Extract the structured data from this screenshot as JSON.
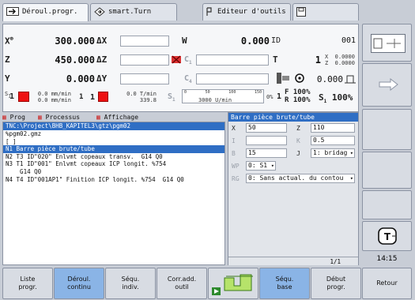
{
  "tabs": [
    {
      "label": "Déroul.progr.",
      "icon": "run-program-icon"
    },
    {
      "label": "smart.Turn",
      "icon": "smart-turn-icon"
    },
    {
      "label": "Editeur d'outils",
      "icon": "tool-editor-icon"
    },
    {
      "label": "",
      "icon": "disk-icon"
    }
  ],
  "axes": {
    "x": {
      "label": "X",
      "sup": "⊕",
      "value": "300.000",
      "delta": "ΔX"
    },
    "z": {
      "label": "Z",
      "value": "450.000",
      "delta": "ΔZ"
    },
    "y": {
      "label": "Y",
      "value": "0.000",
      "delta": "ΔY"
    },
    "w": {
      "label": "W",
      "value": "0.000",
      "id_label": "ID",
      "id_value": "001"
    },
    "c1": {
      "label": "C",
      "sub": "1"
    },
    "c2": {
      "label": "C",
      "sub": "4"
    },
    "t": {
      "label": "T",
      "value": "1",
      "x_label": "X",
      "x_value": "0.0000",
      "z_label": "Z",
      "z_value": "0.0000"
    },
    "spindle_value": "0.000"
  },
  "feeds": {
    "s1_label": "S",
    "s1_sub": "1",
    "s1_count": "1",
    "feed_top": "0.0 mm/min",
    "feed_bot": "0.0 mm/min",
    "k1": "1",
    "k2": "1",
    "feed2_top": "0.0 T/min",
    "feed2_bot": "339.8",
    "s2": "S",
    "s2_sub": "1",
    "rpm": "3000 U/min",
    "rpm_scale": [
      "0",
      "50",
      "100",
      "150"
    ],
    "percent": "0%",
    "f_label": "F",
    "f_pct": "100%",
    "r_label": "R",
    "r_pct": "100%",
    "s_label": "S",
    "s_sub": "1",
    "s_pct": "100%"
  },
  "menu": {
    "prog": "Prog",
    "processus": "Processus",
    "affichage": "Affichage"
  },
  "program": {
    "path": "TNC:\\Project\\BHB_KAPITEL3\\gtz\\pgm02",
    "lines": [
      "%pgm02.gmz",
      "[ ]",
      "N1 Barre pièce brute/tube",
      "N2 T3 ID\"020\" Enlvmt copeaux transv.  G14 Q0",
      "N3 T1 ID\"001\" Enlvmt copeaux ICP longit. %754",
      "    G14 Q0",
      "N4 T4 ID\"001AP1\" Finition ICP longit. %754  G14 Q0"
    ],
    "selected": 2,
    "page": "1/1"
  },
  "form": {
    "title": "Barre pièce brute/tube",
    "x_label": "X",
    "x_value": "50",
    "z_label": "Z",
    "z_value": "110",
    "i_label": "I",
    "i_value": "",
    "k_label": "K",
    "k_value": "0.5",
    "b_label": "B",
    "b_value": "15",
    "j_label": "J",
    "j_value": "1: bridag",
    "wp_label": "WP",
    "wp_value": "0: S1",
    "rg_label": "RG",
    "rg_value": "0: Sans actual. du contou"
  },
  "clock": "14:15",
  "bottom_keys": [
    {
      "label": "Liste\nprogr.",
      "active": false
    },
    {
      "label": "Déroul.\ncontinu",
      "active": true
    },
    {
      "label": "Séqu.\nindiv.",
      "active": false
    },
    {
      "label": "Corr.add.\noutil",
      "active": false
    },
    {
      "label": "",
      "active": false
    },
    {
      "label": "Séqu.\nbase",
      "active": true
    },
    {
      "label": "Début\nprogr.",
      "active": false
    },
    {
      "label": "Retour",
      "active": false
    }
  ]
}
